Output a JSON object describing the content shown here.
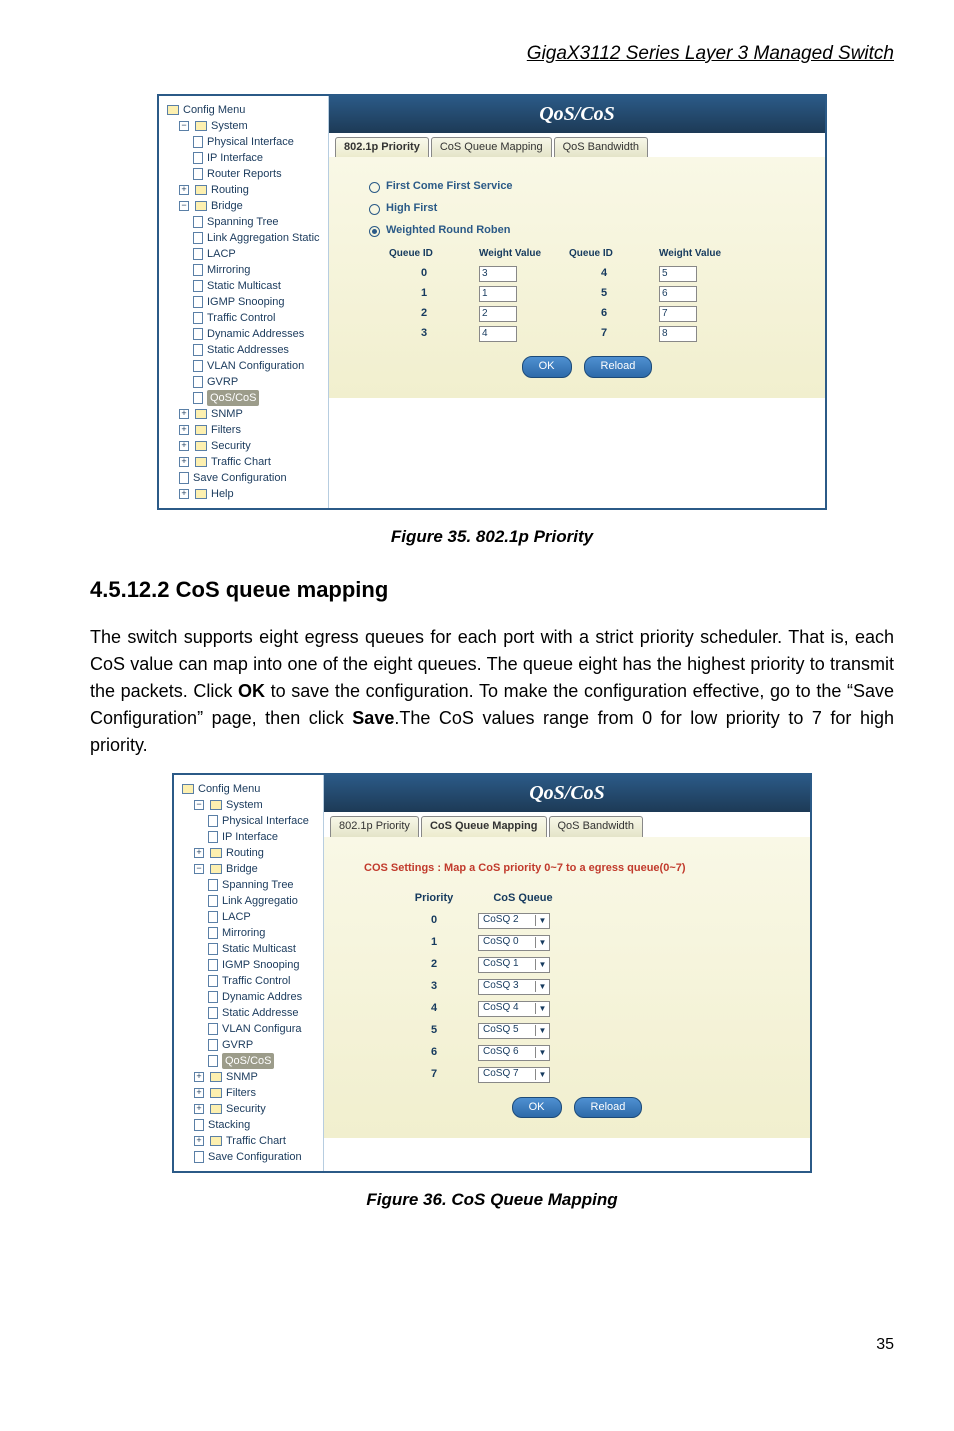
{
  "header": {
    "title": "GigaX3112 Series Layer 3 Managed Switch"
  },
  "fig35": {
    "panelTitle": "QoS/CoS",
    "tabs": {
      "t1": "802.1p Priority",
      "t2": "CoS Queue Mapping",
      "t3": "QoS Bandwidth"
    },
    "radios": {
      "fcfs": "First Come First Service",
      "hf": "High First",
      "wrr": "Weighted Round Roben"
    },
    "cols": {
      "q": "Queue ID",
      "w": "Weight Value"
    },
    "rows": [
      {
        "q": "0",
        "w": "3",
        "q2": "4",
        "w2": "5"
      },
      {
        "q": "1",
        "w": "1",
        "q2": "5",
        "w2": "6"
      },
      {
        "q": "2",
        "w": "2",
        "q2": "6",
        "w2": "7"
      },
      {
        "q": "3",
        "w": "4",
        "q2": "7",
        "w2": "8"
      }
    ],
    "ok": "OK",
    "reload": "Reload",
    "tree": {
      "root": "Config Menu",
      "system": "System",
      "phys": "Physical Interface",
      "ipif": "IP Interface",
      "rr": "Router Reports",
      "routing": "Routing",
      "bridge": "Bridge",
      "span": "Spanning Tree",
      "las": "Link Aggregation Static",
      "lacp": "LACP",
      "mirr": "Mirroring",
      "smc": "Static Multicast",
      "igmp": "IGMP Snooping",
      "traff": "Traffic Control",
      "dyn": "Dynamic Addresses",
      "stat": "Static Addresses",
      "vlan": "VLAN Configuration",
      "gvrp": "GVRP",
      "qos": "QoS/CoS",
      "snmp": "SNMP",
      "filters": "Filters",
      "sec": "Security",
      "tc": "Traffic Chart",
      "save": "Save Configuration",
      "help": "Help"
    },
    "caption": "Figure 35. 802.1p Priority"
  },
  "section": {
    "heading": "4.5.12.2   CoS queue mapping",
    "body": "The switch supports eight egress queues for each port with a strict priority scheduler. That is, each CoS value can map into one of the eight queues. The queue eight has the highest priority to transmit the packets. Click OK to save the configuration. To make the configuration effective, go to the “Save Configuration” page, then click Save.The CoS values range from 0 for low priority to 7 for high priority."
  },
  "fig36": {
    "panelTitle": "QoS/CoS",
    "tabs": {
      "t1": "802.1p Priority",
      "t2": "CoS Queue Mapping",
      "t3": "QoS Bandwidth"
    },
    "err": "COS Settings : Map a CoS priority 0~7 to a egress queue(0~7)",
    "cols": {
      "p": "Priority",
      "cq": "CoS Queue"
    },
    "rows": [
      {
        "p": "0",
        "c": "CoSQ 2"
      },
      {
        "p": "1",
        "c": "CoSQ 0"
      },
      {
        "p": "2",
        "c": "CoSQ 1"
      },
      {
        "p": "3",
        "c": "CoSQ 3"
      },
      {
        "p": "4",
        "c": "CoSQ 4"
      },
      {
        "p": "5",
        "c": "CoSQ 5"
      },
      {
        "p": "6",
        "c": "CoSQ 6"
      },
      {
        "p": "7",
        "c": "CoSQ 7"
      }
    ],
    "ok": "OK",
    "reload": "Reload",
    "tree": {
      "root": "Config Menu",
      "system": "System",
      "phys": "Physical Interface",
      "ipif": "IP Interface",
      "routing": "Routing",
      "bridge": "Bridge",
      "span": "Spanning Tree",
      "lagg": "Link Aggregatio",
      "lacp": "LACP",
      "mirr": "Mirroring",
      "smc": "Static Multicast",
      "igmp": "IGMP Snooping",
      "traff": "Traffic Control",
      "dyn": "Dynamic Addres",
      "stat": "Static Addresse",
      "vlan": "VLAN Configura",
      "gvrp": "GVRP",
      "qos": "QoS/CoS",
      "snmp": "SNMP",
      "filters": "Filters",
      "sec": "Security",
      "stack": "Stacking",
      "tc": "Traffic Chart",
      "save": "Save Configuration"
    },
    "caption": "Figure 36. CoS Queue Mapping"
  },
  "pageNumber": "35"
}
